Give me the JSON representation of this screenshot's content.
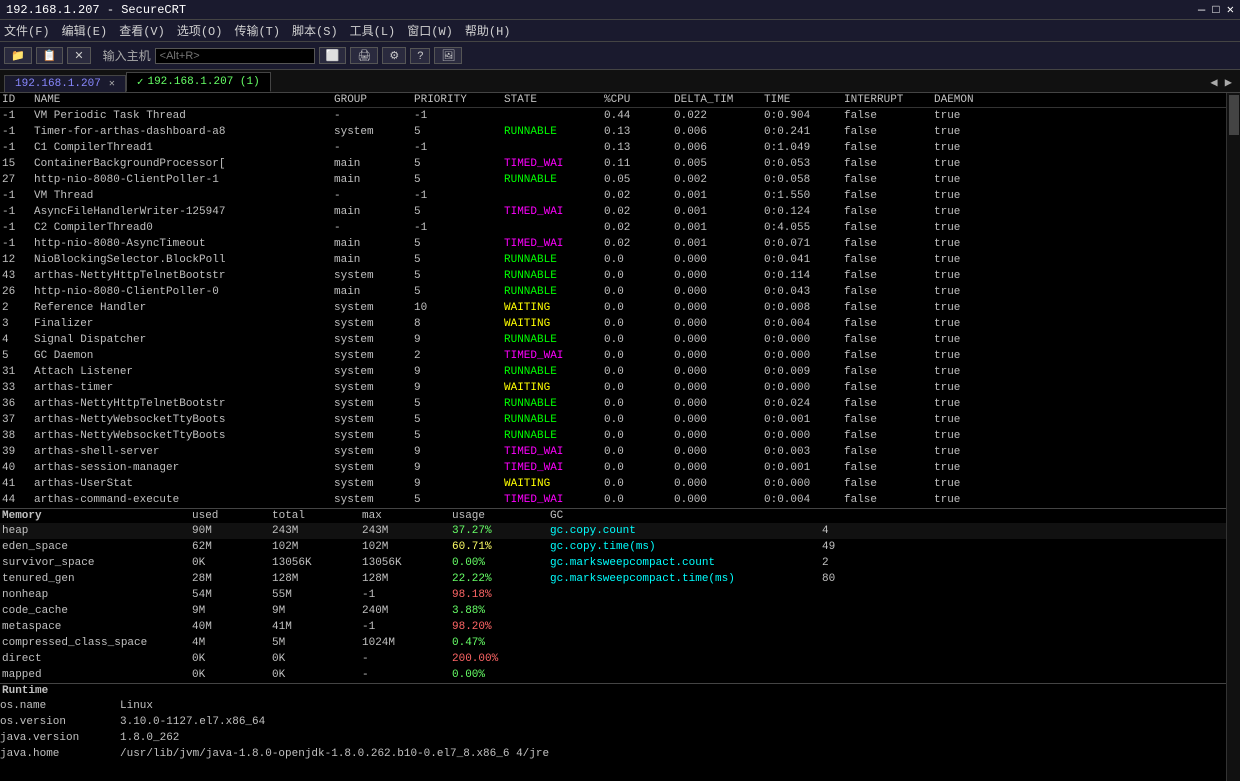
{
  "titleBar": {
    "text": "192.168.1.207 - SecureCRT"
  },
  "menuBar": {
    "items": [
      "文件(F)",
      "编辑(E)",
      "查看(V)",
      "选项(O)",
      "传输(T)",
      "脚本(S)",
      "工具(L)",
      "窗口(W)",
      "帮助(H)"
    ]
  },
  "toolbar": {
    "hostLabel": "输入主机",
    "hostPlaceholder": "<Alt+R>"
  },
  "tabs": [
    {
      "label": "192.168.1.207",
      "active": false,
      "closeable": true,
      "check": ""
    },
    {
      "label": "192.168.1.207 (1)",
      "active": true,
      "closeable": false,
      "check": "✓"
    }
  ],
  "tableHeaders": {
    "id": "ID",
    "name": "NAME",
    "group": "GROUP",
    "priority": "PRIORITY",
    "state": "STATE",
    "cpu": "%CPU",
    "delta": "DELTA_TIM",
    "time": "TIME",
    "interrupt": "INTERRUPT",
    "daemon": "DAEMON"
  },
  "threads": [
    {
      "id": "-1",
      "name": "VM Periodic Task Thread",
      "group": "-",
      "priority": "-1",
      "state": "",
      "cpu": "0.44",
      "delta": "0.022",
      "time": "0:0.904",
      "interrupt": "false",
      "daemon": "true"
    },
    {
      "id": "-1",
      "name": "Timer-for-arthas-dashboard-a8",
      "group": "system",
      "priority": "5",
      "state": "RUNNABLE",
      "cpu": "0.13",
      "delta": "0.006",
      "time": "0:0.241",
      "interrupt": "false",
      "daemon": "true"
    },
    {
      "id": "-1",
      "name": "C1 CompilerThread1",
      "group": "-",
      "priority": "-1",
      "state": "",
      "cpu": "0.13",
      "delta": "0.006",
      "time": "0:1.049",
      "interrupt": "false",
      "daemon": "true"
    },
    {
      "id": "15",
      "name": "ContainerBackgroundProcessor[",
      "group": "main",
      "priority": "5",
      "state": "TIMED_WAI",
      "cpu": "0.11",
      "delta": "0.005",
      "time": "0:0.053",
      "interrupt": "false",
      "daemon": "true"
    },
    {
      "id": "27",
      "name": "http-nio-8080-ClientPoller-1",
      "group": "main",
      "priority": "5",
      "state": "RUNNABLE",
      "cpu": "0.05",
      "delta": "0.002",
      "time": "0:0.058",
      "interrupt": "false",
      "daemon": "true"
    },
    {
      "id": "-1",
      "name": "VM Thread",
      "group": "-",
      "priority": "-1",
      "state": "",
      "cpu": "0.02",
      "delta": "0.001",
      "time": "0:1.550",
      "interrupt": "false",
      "daemon": "true"
    },
    {
      "id": "-1",
      "name": "AsyncFileHandlerWriter-125947",
      "group": "main",
      "priority": "5",
      "state": "TIMED_WAI",
      "cpu": "0.02",
      "delta": "0.001",
      "time": "0:0.124",
      "interrupt": "false",
      "daemon": "true"
    },
    {
      "id": "-1",
      "name": "C2 CompilerThread0",
      "group": "-",
      "priority": "-1",
      "state": "",
      "cpu": "0.02",
      "delta": "0.001",
      "time": "0:4.055",
      "interrupt": "false",
      "daemon": "true"
    },
    {
      "id": "-1",
      "name": "http-nio-8080-AsyncTimeout",
      "group": "main",
      "priority": "5",
      "state": "TIMED_WAI",
      "cpu": "0.02",
      "delta": "0.001",
      "time": "0:0.071",
      "interrupt": "false",
      "daemon": "true"
    },
    {
      "id": "12",
      "name": "NioBlockingSelector.BlockPoll",
      "group": "main",
      "priority": "5",
      "state": "RUNNABLE",
      "cpu": "0.0",
      "delta": "0.000",
      "time": "0:0.041",
      "interrupt": "false",
      "daemon": "true"
    },
    {
      "id": "43",
      "name": "arthas-NettyHttpTelnetBootstr",
      "group": "system",
      "priority": "5",
      "state": "RUNNABLE",
      "cpu": "0.0",
      "delta": "0.000",
      "time": "0:0.114",
      "interrupt": "false",
      "daemon": "true"
    },
    {
      "id": "26",
      "name": "http-nio-8080-ClientPoller-0",
      "group": "main",
      "priority": "5",
      "state": "RUNNABLE",
      "cpu": "0.0",
      "delta": "0.000",
      "time": "0:0.043",
      "interrupt": "false",
      "daemon": "true"
    },
    {
      "id": "2",
      "name": "Reference Handler",
      "group": "system",
      "priority": "10",
      "state": "WAITING",
      "cpu": "0.0",
      "delta": "0.000",
      "time": "0:0.008",
      "interrupt": "false",
      "daemon": "true"
    },
    {
      "id": "3",
      "name": "Finalizer",
      "group": "system",
      "priority": "8",
      "state": "WAITING",
      "cpu": "0.0",
      "delta": "0.000",
      "time": "0:0.004",
      "interrupt": "false",
      "daemon": "true"
    },
    {
      "id": "4",
      "name": "Signal Dispatcher",
      "group": "system",
      "priority": "9",
      "state": "RUNNABLE",
      "cpu": "0.0",
      "delta": "0.000",
      "time": "0:0.000",
      "interrupt": "false",
      "daemon": "true"
    },
    {
      "id": "5",
      "name": "GC Daemon",
      "group": "system",
      "priority": "2",
      "state": "TIMED_WAI",
      "cpu": "0.0",
      "delta": "0.000",
      "time": "0:0.000",
      "interrupt": "false",
      "daemon": "true"
    },
    {
      "id": "31",
      "name": "Attach Listener",
      "group": "system",
      "priority": "9",
      "state": "RUNNABLE",
      "cpu": "0.0",
      "delta": "0.000",
      "time": "0:0.009",
      "interrupt": "false",
      "daemon": "true"
    },
    {
      "id": "33",
      "name": "arthas-timer",
      "group": "system",
      "priority": "9",
      "state": "WAITING",
      "cpu": "0.0",
      "delta": "0.000",
      "time": "0:0.000",
      "interrupt": "false",
      "daemon": "true"
    },
    {
      "id": "36",
      "name": "arthas-NettyHttpTelnetBootstr",
      "group": "system",
      "priority": "5",
      "state": "RUNNABLE",
      "cpu": "0.0",
      "delta": "0.000",
      "time": "0:0.024",
      "interrupt": "false",
      "daemon": "true"
    },
    {
      "id": "37",
      "name": "arthas-NettyWebsocketTtyBoots",
      "group": "system",
      "priority": "5",
      "state": "RUNNABLE",
      "cpu": "0.0",
      "delta": "0.000",
      "time": "0:0.001",
      "interrupt": "false",
      "daemon": "true"
    },
    {
      "id": "38",
      "name": "arthas-NettyWebsocketTtyBoots",
      "group": "system",
      "priority": "5",
      "state": "RUNNABLE",
      "cpu": "0.0",
      "delta": "0.000",
      "time": "0:0.000",
      "interrupt": "false",
      "daemon": "true"
    },
    {
      "id": "39",
      "name": "arthas-shell-server",
      "group": "system",
      "priority": "9",
      "state": "TIMED_WAI",
      "cpu": "0.0",
      "delta": "0.000",
      "time": "0:0.003",
      "interrupt": "false",
      "daemon": "true"
    },
    {
      "id": "40",
      "name": "arthas-session-manager",
      "group": "system",
      "priority": "9",
      "state": "TIMED_WAI",
      "cpu": "0.0",
      "delta": "0.000",
      "time": "0:0.001",
      "interrupt": "false",
      "daemon": "true"
    },
    {
      "id": "41",
      "name": "arthas-UserStat",
      "group": "system",
      "priority": "9",
      "state": "WAITING",
      "cpu": "0.0",
      "delta": "0.000",
      "time": "0:0.000",
      "interrupt": "false",
      "daemon": "true"
    },
    {
      "id": "44",
      "name": "arthas-command-execute",
      "group": "system",
      "priority": "5",
      "state": "TIMED_WAI",
      "cpu": "0.0",
      "delta": "0.000",
      "time": "0:0.004",
      "interrupt": "false",
      "daemon": "true"
    }
  ],
  "memorySectionLabel": "Memory",
  "memoryHeaders": {
    "col1": "",
    "used": "used",
    "total": "total",
    "max": "max",
    "usage": "usage",
    "gc": "GC"
  },
  "memoryRows": [
    {
      "name": "heap",
      "used": "90M",
      "total": "243M",
      "max": "243M",
      "usage": "37.27%",
      "usageClass": "usage-low",
      "gcName": "gc.copy.count",
      "gcVal": "4"
    },
    {
      "name": "eden_space",
      "used": "62M",
      "total": "102M",
      "max": "102M",
      "usage": "60.71%",
      "usageClass": "usage-med",
      "gcName": "gc.copy.time(ms)",
      "gcVal": "49"
    },
    {
      "name": "survivor_space",
      "used": "0K",
      "total": "13056K",
      "max": "13056K",
      "usage": "0.00%",
      "usageClass": "usage-low",
      "gcName": "gc.marksweepcompact.count",
      "gcVal": "2"
    },
    {
      "name": "tenured_gen",
      "used": "28M",
      "total": "128M",
      "max": "128M",
      "usage": "22.22%",
      "usageClass": "usage-low",
      "gcName": "gc.marksweepcompact.time(ms)",
      "gcVal": "80"
    },
    {
      "name": "nonheap",
      "used": "54M",
      "total": "55M",
      "max": "-1",
      "usage": "98.18%",
      "usageClass": "usage-high",
      "gcName": "",
      "gcVal": ""
    },
    {
      "name": "code_cache",
      "used": "9M",
      "total": "9M",
      "max": "240M",
      "usage": "3.88%",
      "usageClass": "usage-low",
      "gcName": "",
      "gcVal": ""
    },
    {
      "name": "metaspace",
      "used": "40M",
      "total": "41M",
      "max": "-1",
      "usage": "98.20%",
      "usageClass": "usage-high",
      "gcName": "",
      "gcVal": ""
    },
    {
      "name": "compressed_class_space",
      "used": "4M",
      "total": "5M",
      "max": "1024M",
      "usage": "0.47%",
      "usageClass": "usage-low",
      "gcName": "",
      "gcVal": ""
    },
    {
      "name": "direct",
      "used": "0K",
      "total": "0K",
      "max": "-",
      "usage": "200.00%",
      "usageClass": "usage-high",
      "gcName": "",
      "gcVal": ""
    },
    {
      "name": "mapped",
      "used": "0K",
      "total": "0K",
      "max": "-",
      "usage": "0.00%",
      "usageClass": "usage-low",
      "gcName": "",
      "gcVal": ""
    }
  ],
  "runtimeSectionLabel": "Runtime",
  "runtimeRows": [
    {
      "key": "os.name",
      "val": "Linux"
    },
    {
      "key": "os.version",
      "val": "3.10.0-1127.el7.x86_64"
    },
    {
      "key": "java.version",
      "val": "1.8.0_262"
    },
    {
      "key": "java.home",
      "val": "/usr/lib/jvm/java-1.8.0-openjdk-1.8.0.262.b10-0.el7_8.x86_6 4/jre"
    }
  ]
}
